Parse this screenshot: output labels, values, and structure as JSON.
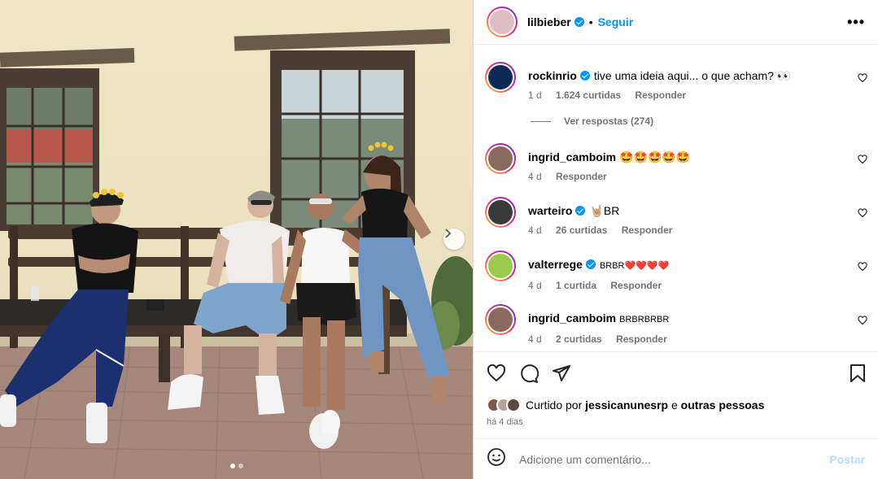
{
  "post": {
    "username": "lilbieber",
    "follow_label": "Seguir",
    "bullet": "•",
    "more_label": "•••",
    "slides": {
      "count": 2,
      "active": 1
    }
  },
  "comments": [
    {
      "username": "rockinrio",
      "verified": true,
      "text": "tive uma ideia aqui... o que acham? 👀",
      "age": "1 d",
      "likes": "1.624 curtidas",
      "reply": "Responder"
    },
    {
      "username": "ingrid_camboim",
      "verified": false,
      "text": "🤩🤩🤩🤩🤩",
      "age": "4 d",
      "likes": "",
      "reply": "Responder"
    },
    {
      "username": "warteiro",
      "verified": true,
      "text": "🤘🏼BR",
      "age": "4 d",
      "likes": "26 curtidas",
      "reply": "Responder"
    },
    {
      "username": "valterrege",
      "verified": true,
      "text": "BRBR❤️❤️❤️❤️",
      "age": "4 d",
      "likes": "1 curtida",
      "reply": "Responder"
    },
    {
      "username": "ingrid_camboim",
      "verified": false,
      "text": "BRBRBRBR",
      "age": "4 d",
      "likes": "2 curtidas",
      "reply": "Responder"
    }
  ],
  "view_replies": "Ver respostas (274)",
  "likes_line": {
    "prefix": "Curtido por",
    "user": "jessicanunesrp",
    "conj": "e",
    "rest": "outras pessoas"
  },
  "time_ago": "há 4 dias",
  "add_comment": {
    "placeholder": "Adicione um comentário...",
    "post_label": "Postar"
  },
  "colors": {
    "accent": "#0095f6",
    "post_disabled": "#b3dbff",
    "meta": "#737373"
  }
}
